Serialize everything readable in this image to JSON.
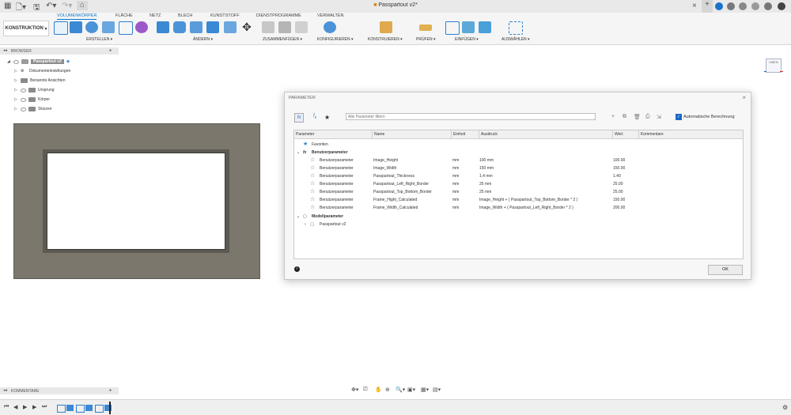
{
  "window": {
    "title": "Passpartout v2*"
  },
  "toolbar": {
    "workspace": "KONSTRUKTION",
    "tabs": [
      "VOLUMENKÖRPER",
      "FLÄCHE",
      "NETZ",
      "BLECH",
      "KUNSTSTOFF",
      "DIENSTPROGRAMME",
      "VERWALTEN"
    ],
    "active_tab": "VOLUMENKÖRPER",
    "groups": [
      "ERSTELLEN ▾",
      "ÄNDERN ▾",
      "ZUSAMMENFÜGEN ▾",
      "KONFIGURIEREN ▾",
      "KONSTRUIEREN ▾",
      "PRÜFEN ▾",
      "EINFÜGEN ▾",
      "AUSWÄHLEN ▾"
    ]
  },
  "browser": {
    "header": "BROWSER",
    "root": "Passpartout v2",
    "items": [
      "Dokumenteinstellungen",
      "Benannte Ansichten",
      "Ursprung",
      "Körper",
      "Skizzen"
    ]
  },
  "viewcube": {
    "label": "OBEN"
  },
  "dialog": {
    "title": "PARAMETER",
    "filter_placeholder": "Alle Parameter filtern",
    "auto_calc_label": "Automatische Berechnung",
    "columns": [
      "Parameter",
      "Name",
      "Einheit",
      "Ausdruck",
      "Wert",
      "Kommentare"
    ],
    "favorites_label": "Favoriten",
    "user_params_label": "Benutzerparameter",
    "rows": [
      {
        "param": "Benutzerparameter",
        "name": "Image_Height",
        "unit": "mm",
        "expr": "100 mm",
        "value": "100.00"
      },
      {
        "param": "Benutzerparameter",
        "name": "Image_Width",
        "unit": "mm",
        "expr": "150 mm",
        "value": "150.00"
      },
      {
        "param": "Benutzerparameter",
        "name": "Passpartout_Thickness",
        "unit": "mm",
        "expr": "1.4 mm",
        "value": "1.40"
      },
      {
        "param": "Benutzerparameter",
        "name": "Passpartout_Left_Right_Border",
        "unit": "mm",
        "expr": "25 mm",
        "value": "25.00"
      },
      {
        "param": "Benutzerparameter",
        "name": "Passpartout_Top_Bottom_Border",
        "unit": "mm",
        "expr": "25 mm",
        "value": "25.00"
      },
      {
        "param": "Benutzerparameter",
        "name": "Frame_Hight_Calculated",
        "unit": "mm",
        "expr": "Image_Height + ( Passpartout_Top_Bottom_Border * 2 )",
        "value": "150.00"
      },
      {
        "param": "Benutzerparameter",
        "name": "Frame_Width_Calculated",
        "unit": "mm",
        "expr": "Image_Width + ( Passpartout_Left_Right_Border * 2 )",
        "value": "200.00"
      }
    ],
    "model_params_label": "Modellparameter",
    "model_item": "Passpartout v2",
    "ok_label": "OK"
  },
  "comments": {
    "header": "KOMMENTARE"
  },
  "colors": {
    "accent": "#0a74c9",
    "model_frame": "#7b776d"
  }
}
